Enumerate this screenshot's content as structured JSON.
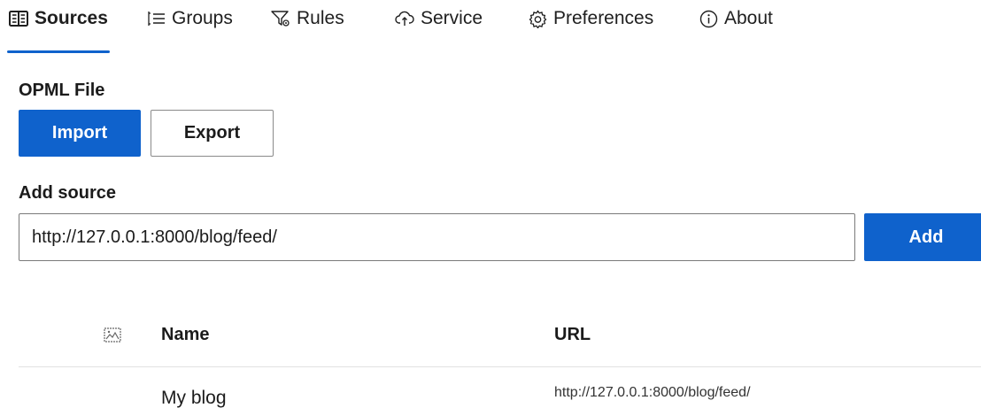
{
  "tabs": [
    {
      "label": "Sources",
      "icon": "sources-icon",
      "active": true
    },
    {
      "label": "Groups",
      "icon": "groups-icon",
      "active": false
    },
    {
      "label": "Rules",
      "icon": "rules-icon",
      "active": false
    },
    {
      "label": "Service",
      "icon": "service-icon",
      "active": false
    },
    {
      "label": "Preferences",
      "icon": "preferences-icon",
      "active": false
    },
    {
      "label": "About",
      "icon": "about-icon",
      "active": false
    }
  ],
  "opml": {
    "heading": "OPML File",
    "import_label": "Import",
    "export_label": "Export"
  },
  "add_source": {
    "heading": "Add source",
    "input_value": "http://127.0.0.1:8000/blog/feed/",
    "add_label": "Add"
  },
  "table": {
    "icon_column": "image-icon",
    "columns": {
      "name": "Name",
      "url": "URL"
    },
    "rows": [
      {
        "name": "My blog",
        "url": "http://127.0.0.1:8000/blog/feed/"
      }
    ]
  },
  "colors": {
    "accent": "#0f62cc",
    "text": "#1b1b1b",
    "divider": "#e1e1e1"
  }
}
